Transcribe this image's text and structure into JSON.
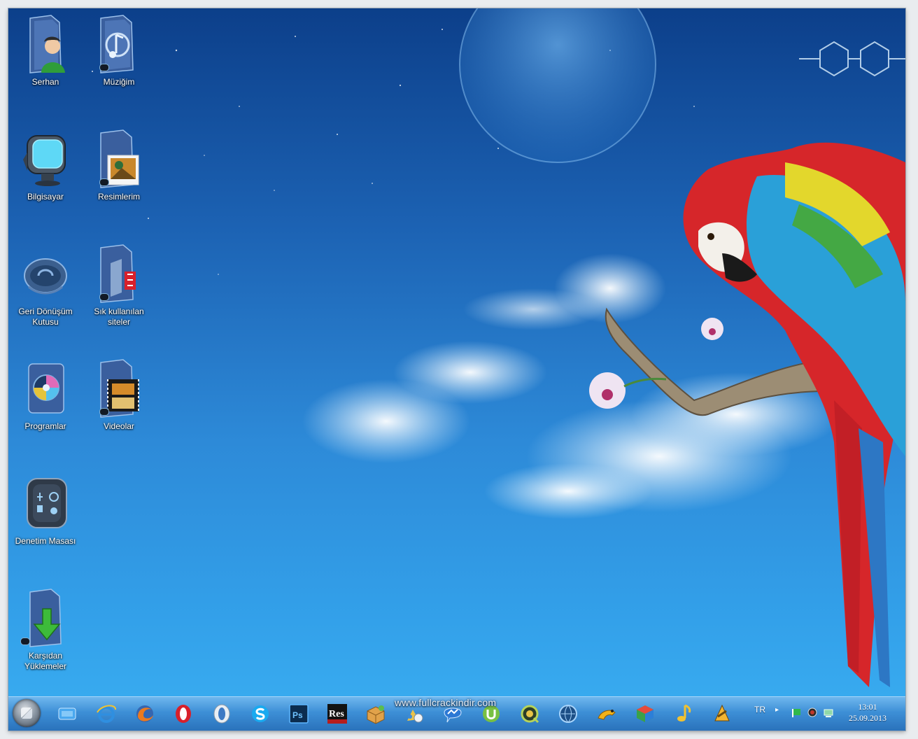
{
  "desktop": {
    "icons": [
      {
        "label": "Serhan",
        "icon": "user-folder-icon"
      },
      {
        "label": "Müziğim",
        "icon": "music-folder-icon"
      },
      {
        "label": "Bilgisayar",
        "icon": "computer-icon"
      },
      {
        "label": "Resimlerim",
        "icon": "pictures-folder-icon"
      },
      {
        "label": "Geri Dönüşüm Kutusu",
        "icon": "recycle-bin-icon"
      },
      {
        "label": "Sık kullanılan siteler",
        "icon": "favorites-folder-icon"
      },
      {
        "label": "Programlar",
        "icon": "programs-icon"
      },
      {
        "label": "Videolar",
        "icon": "videos-folder-icon"
      },
      {
        "label": "Denetim Masası",
        "icon": "control-panel-icon"
      },
      {
        "label": "Karşıdan Yüklemeler",
        "icon": "downloads-folder-icon"
      }
    ]
  },
  "taskbar": {
    "watermark": "www.fullcrackindir.com",
    "pinned": [
      "show-desktop-icon",
      "internet-explorer-icon",
      "firefox-icon",
      "opera-icon",
      "opera-next-icon",
      "skype-icon",
      "photoshop-icon",
      "resource-hacker-icon",
      "package-icon",
      "paint-icon",
      "messenger-icon",
      "utorrent-icon",
      "quicktime-icon",
      "globe-app-icon",
      "frog-app-icon",
      "cube-app-icon",
      "music-note-icon",
      "winamp-icon"
    ],
    "res_label": "Res"
  },
  "tray": {
    "language": "TR",
    "overflow_arrow": "▸",
    "icons": [
      "flag-icon",
      "volume-icon",
      "network-icon"
    ],
    "time": "13:01",
    "date": "25.09.2013"
  },
  "colors": {
    "sky_top": "#0c3f8a",
    "sky_bottom": "#3aaef1",
    "taskbar": "#3d8fd6"
  }
}
